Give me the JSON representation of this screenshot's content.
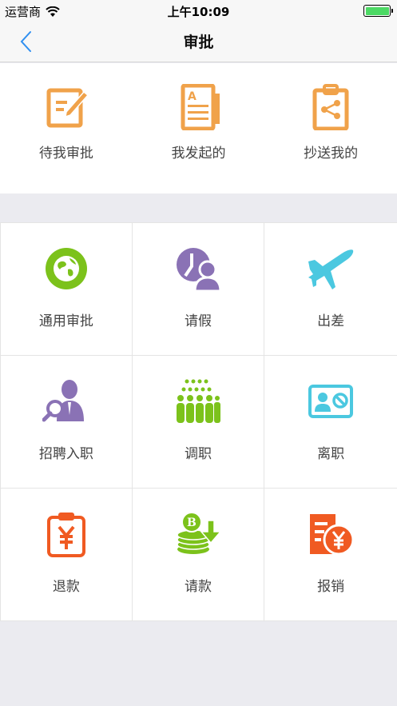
{
  "status_bar": {
    "carrier": "运营商",
    "time": "上午10:09"
  },
  "nav": {
    "title": "审批"
  },
  "top_items": [
    {
      "label": "待我审批",
      "icon": "edit-document-icon"
    },
    {
      "label": "我发起的",
      "icon": "document-icon"
    },
    {
      "label": "抄送我的",
      "icon": "clipboard-share-icon"
    }
  ],
  "grid_items": [
    {
      "label": "通用审批",
      "icon": "globe-icon"
    },
    {
      "label": "请假",
      "icon": "clock-person-icon"
    },
    {
      "label": "出差",
      "icon": "airplane-icon"
    },
    {
      "label": "招聘入职",
      "icon": "person-search-icon"
    },
    {
      "label": "调职",
      "icon": "people-group-icon"
    },
    {
      "label": "离职",
      "icon": "id-card-cancel-icon"
    },
    {
      "label": "退款",
      "icon": "yen-clipboard-icon"
    },
    {
      "label": "请款",
      "icon": "coins-download-icon"
    },
    {
      "label": "报销",
      "icon": "receipt-yen-icon"
    }
  ],
  "colors": {
    "orange": "#f0a24a",
    "green": "#7cc21b",
    "purple": "#8a72b5",
    "cyan": "#4bc8e0",
    "red_orange": "#f05a22"
  }
}
